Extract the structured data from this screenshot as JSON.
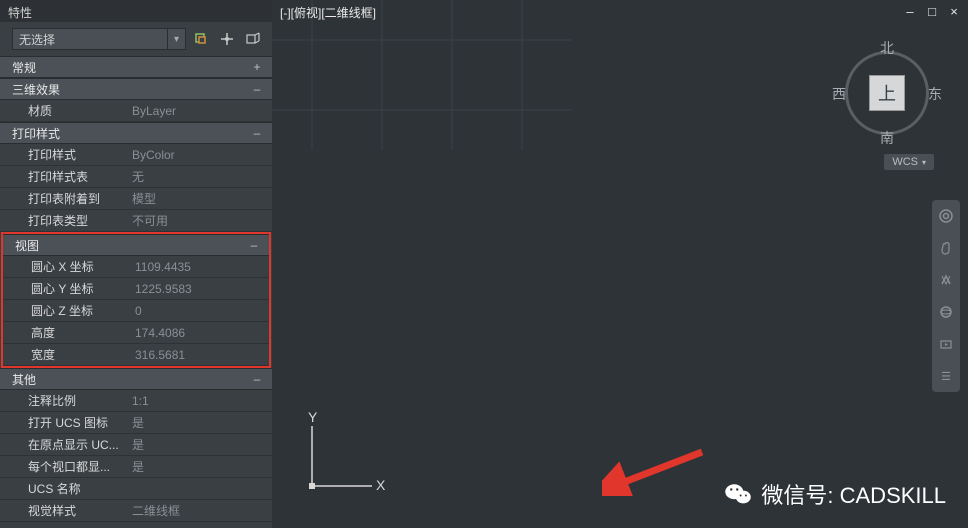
{
  "panel": {
    "title": "特性",
    "selection": "无选择",
    "toolbar_icons": [
      "toggle-pim-icon",
      "quick-select-icon",
      "object-isolate-icon"
    ],
    "sections": {
      "general": {
        "label": "常规",
        "collapsed": true
      },
      "fx3d": {
        "label": "三维效果",
        "rows": [
          {
            "k": "材质",
            "v": "ByLayer"
          }
        ]
      },
      "plot": {
        "label": "打印样式",
        "rows": [
          {
            "k": "打印样式",
            "v": "ByColor"
          },
          {
            "k": "打印样式表",
            "v": "无"
          },
          {
            "k": "打印表附着到",
            "v": "模型"
          },
          {
            "k": "打印表类型",
            "v": "不可用"
          }
        ]
      },
      "view": {
        "label": "视图",
        "rows": [
          {
            "k": "圆心 X 坐标",
            "v": "1109.4435"
          },
          {
            "k": "圆心 Y 坐标",
            "v": "1225.9583"
          },
          {
            "k": "圆心 Z 坐标",
            "v": "0"
          },
          {
            "k": "高度",
            "v": "174.4086"
          },
          {
            "k": "宽度",
            "v": "316.5681"
          }
        ]
      },
      "misc": {
        "label": "其他",
        "rows": [
          {
            "k": "注释比例",
            "v": "1:1"
          },
          {
            "k": "打开 UCS 图标",
            "v": "是"
          },
          {
            "k": "在原点显示 UC...",
            "v": "是"
          },
          {
            "k": "每个视口都显...",
            "v": "是"
          },
          {
            "k": "UCS 名称",
            "v": ""
          },
          {
            "k": "视觉样式",
            "v": "二维线框"
          }
        ]
      }
    }
  },
  "canvas": {
    "viewport_label": "[-][俯视][二维线框]",
    "viewcube": {
      "face": "上",
      "north": "北",
      "south": "南",
      "west": "西",
      "east": "东"
    },
    "wcs": "WCS",
    "ucs": {
      "x": "X",
      "y": "Y"
    }
  },
  "watermark": "微信号: CADSKILL"
}
